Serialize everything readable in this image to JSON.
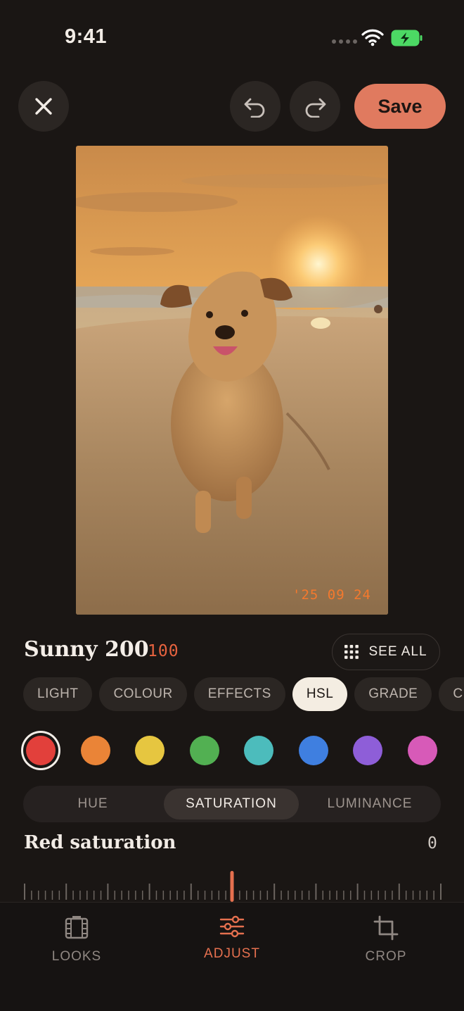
{
  "status_bar": {
    "time": "9:41"
  },
  "toolbar": {
    "save_label": "Save"
  },
  "photo": {
    "stamp": "'25 09 24"
  },
  "preset": {
    "name": "Sunny 200",
    "strength": "100",
    "see_all_label": "SEE ALL"
  },
  "tabs": [
    {
      "label": "LIGHT",
      "active": false
    },
    {
      "label": "COLOUR",
      "active": false
    },
    {
      "label": "EFFECTS",
      "active": false
    },
    {
      "label": "HSL",
      "active": true
    },
    {
      "label": "GRADE",
      "active": false
    },
    {
      "label": "CU",
      "active": false
    }
  ],
  "swatches": [
    {
      "name": "red",
      "color": "#e2403b",
      "selected": true
    },
    {
      "name": "orange",
      "color": "#ea8437",
      "selected": false
    },
    {
      "name": "yellow",
      "color": "#e6c640",
      "selected": false
    },
    {
      "name": "green",
      "color": "#52b052",
      "selected": false
    },
    {
      "name": "aqua",
      "color": "#4cbcbc",
      "selected": false
    },
    {
      "name": "blue",
      "color": "#3f7fe0",
      "selected": false
    },
    {
      "name": "purple",
      "color": "#8e5ed8",
      "selected": false
    },
    {
      "name": "magenta",
      "color": "#d75ab8",
      "selected": false
    }
  ],
  "hsl_mode": {
    "hue": "HUE",
    "saturation": "SATURATION",
    "luminance": "LUMINANCE",
    "active": "saturation"
  },
  "parameter": {
    "label": "Red saturation",
    "value": "0"
  },
  "bottom_nav": {
    "looks": "LOOKS",
    "adjust": "ADJUST",
    "crop": "CROP",
    "active": "adjust"
  },
  "colors": {
    "accent": "#e5704f",
    "save": "#e07a5f",
    "background": "#1a1614"
  }
}
